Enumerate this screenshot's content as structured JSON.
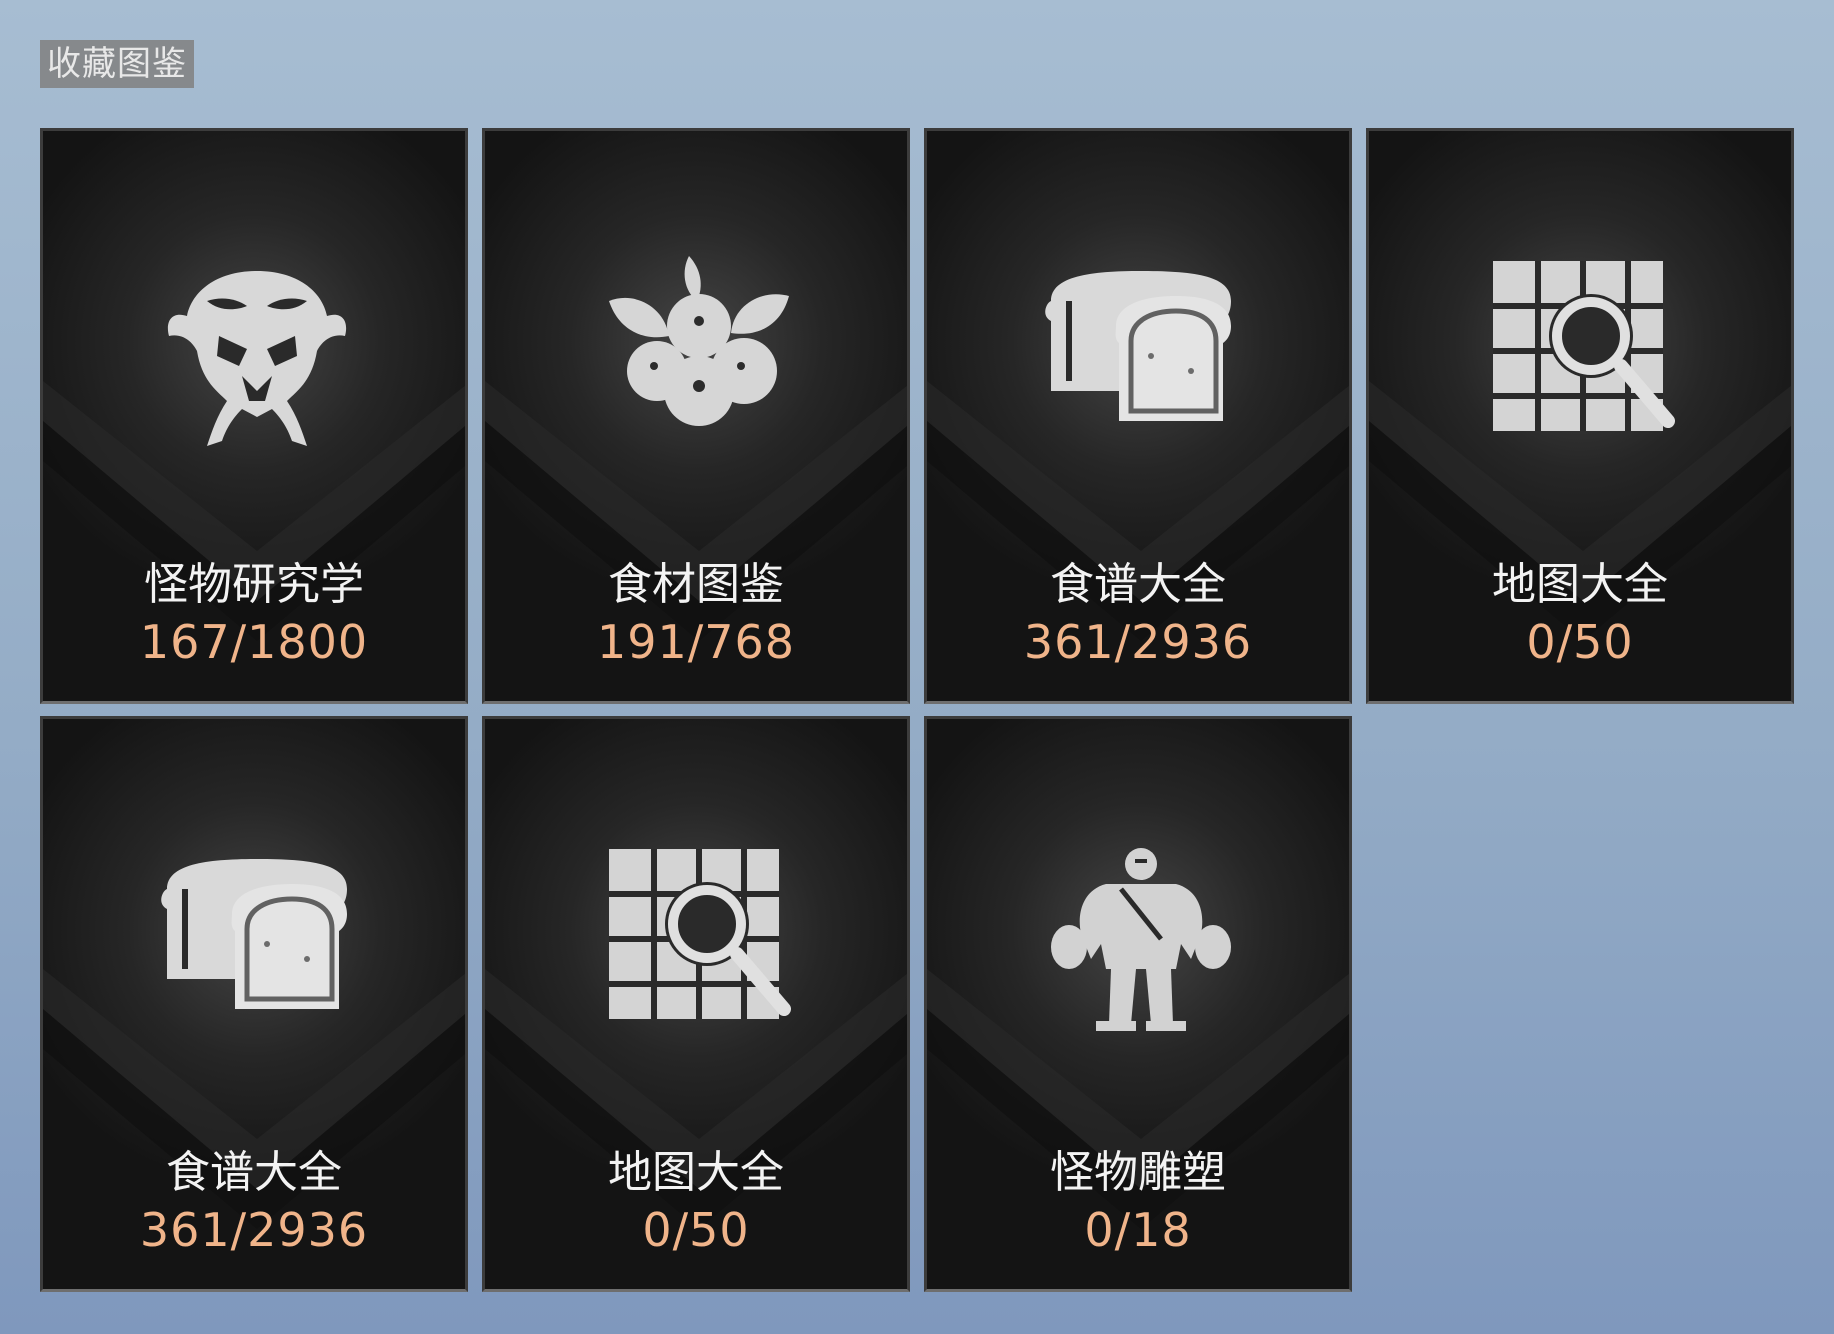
{
  "header": {
    "title": "收藏图鉴"
  },
  "colors": {
    "card_bg": "#1a1a1a",
    "count_text": "#f0b48a",
    "name_text": "#f3f3f3",
    "page_bg": "#97aec7"
  },
  "cards": [
    {
      "name": "怪物研究学",
      "count": "167/1800",
      "icon": "monster-skull-icon"
    },
    {
      "name": "食材图鉴",
      "count": "191/768",
      "icon": "berries-icon"
    },
    {
      "name": "食谱大全",
      "count": "361/2936",
      "icon": "bread-icon"
    },
    {
      "name": "地图大全",
      "count": "0/50",
      "icon": "map-magnifier-icon"
    },
    {
      "name": "食谱大全",
      "count": "361/2936",
      "icon": "bread-icon"
    },
    {
      "name": "地图大全",
      "count": "0/50",
      "icon": "map-magnifier-icon"
    },
    {
      "name": "怪物雕塑",
      "count": "0/18",
      "icon": "monster-statue-icon"
    }
  ]
}
